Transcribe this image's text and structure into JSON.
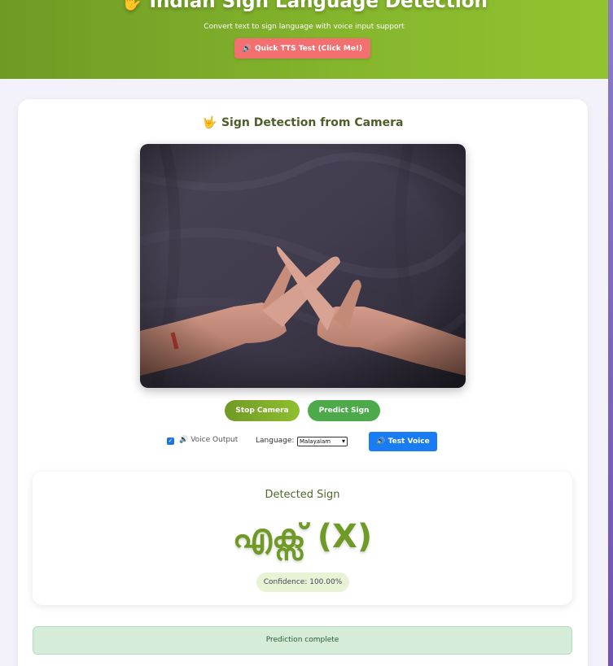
{
  "header": {
    "icon": "hand-icon",
    "title": "Indian Sign Language Detection",
    "subtitle": "Convert text to sign language with voice input support",
    "tts_button_icon": "speaker-icon",
    "tts_button_label": "Quick TTS Test (Click Me!)"
  },
  "camera_section": {
    "icon": "hand-icon",
    "title": "Sign Detection from Camera",
    "video_content": "live camera feed showing two hands crossing index fingers in an X sign",
    "stop_button_label": "Stop Camera",
    "predict_button_label": "Predict Sign"
  },
  "voice_controls": {
    "voice_output_checked": true,
    "voice_output_icon": "speaker-icon",
    "voice_output_label": "Voice Output",
    "language_label": "Language:",
    "language_selected": "Malayalam",
    "test_voice_icon": "speaker-icon",
    "test_voice_label": "Test Voice"
  },
  "result": {
    "label": "Detected Sign",
    "value": "എക്സ് (X)",
    "confidence": "Confidence: 100.00%"
  },
  "status": {
    "message": "Prediction complete"
  },
  "colors": {
    "header_green": "#84b52c",
    "tts_red": "#f36f70",
    "predict_green": "#4caa4a",
    "voice_blue": "#1a7cf2",
    "result_green": "#6f9a25",
    "status_bg": "#d5ecd9"
  }
}
